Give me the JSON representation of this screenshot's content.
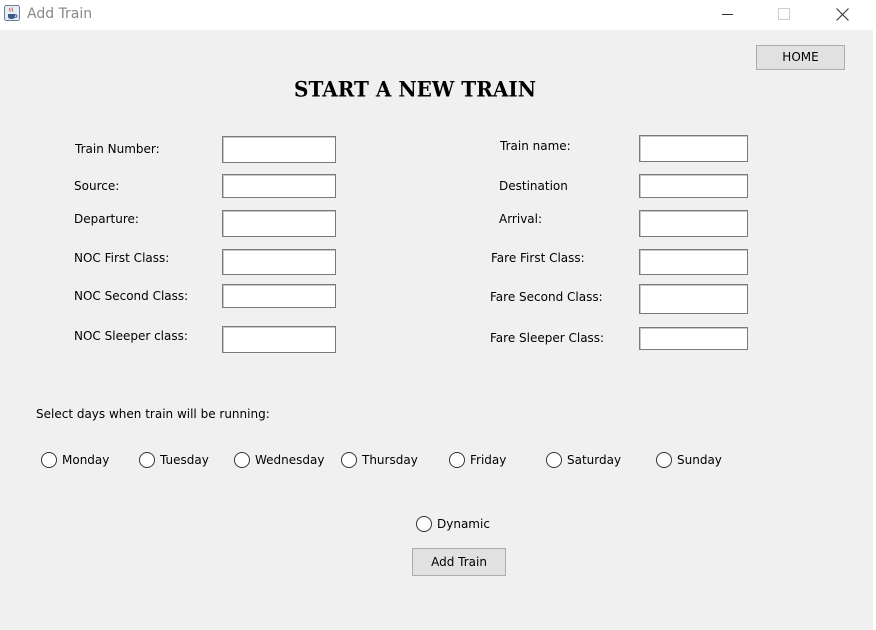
{
  "window": {
    "title": "Add Train",
    "icon": "java-coffee-cup-icon",
    "controls": [
      "minimize-icon",
      "maximize-icon",
      "close-icon"
    ]
  },
  "home_button": "HOME",
  "heading": "START A NEW TRAIN",
  "form": {
    "train_number_label": "Train Number:",
    "train_name_label": "Train name:",
    "source_label": "Source:",
    "destination_label": "Destination",
    "departure_label": "Departure:",
    "arrival_label": "Arrival:",
    "noc_first_label": "NOC First Class:",
    "fare_first_label": "Fare First Class:",
    "noc_second_label": "NOC Second Class:",
    "fare_second_label": "Fare Second Class:",
    "noc_sleeper_label": "NOC Sleeper class:",
    "fare_sleeper_label": "Fare Sleeper Class:",
    "values": {
      "train_number": "",
      "train_name": "",
      "source": "",
      "destination": "",
      "departure": "",
      "arrival": "",
      "noc_first": "",
      "fare_first": "",
      "noc_second": "",
      "fare_second": "",
      "noc_sleeper": "",
      "fare_sleeper": ""
    }
  },
  "days": {
    "prompt": "Select days when train will be running:",
    "options": [
      "Monday",
      "Tuesday",
      "Wednesday",
      "Thursday",
      "Friday",
      "Saturday",
      "Sunday"
    ],
    "selected": []
  },
  "dynamic_label": "Dynamic",
  "dynamic_selected": false,
  "add_train_button": "Add Train"
}
